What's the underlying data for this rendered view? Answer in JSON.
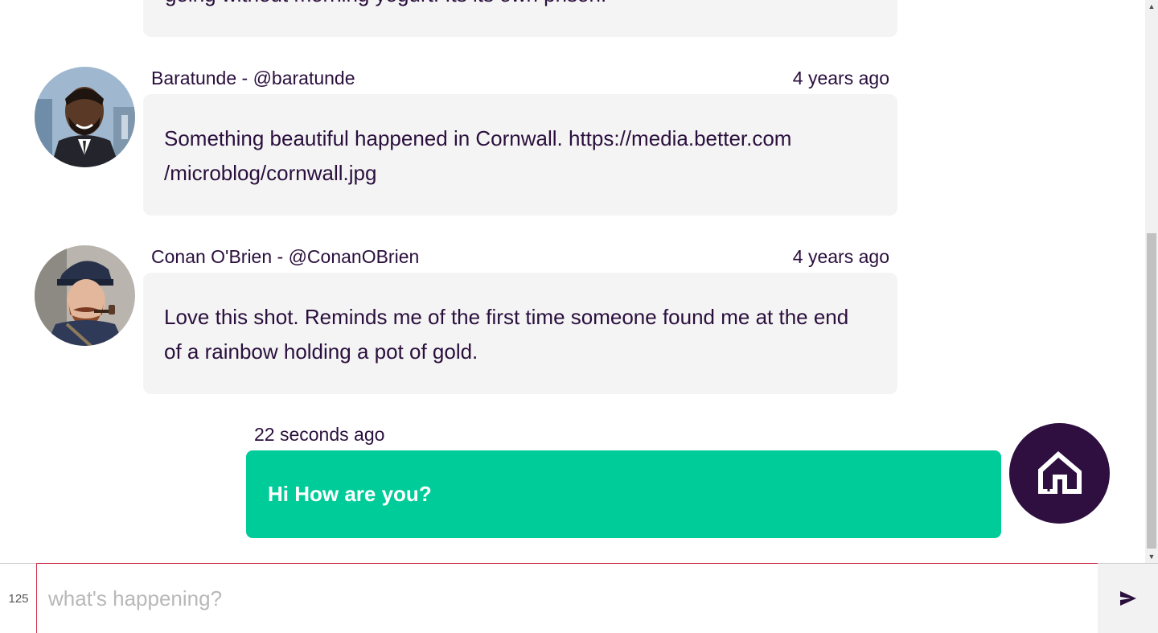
{
  "feed": {
    "truncated_text": "going without morning yogurt. Its its own prison.",
    "messages": [
      {
        "author": "Baratunde - @baratunde",
        "time": "4 years ago",
        "line1": "Something beautiful happened in Cornwall. https://media.better.com",
        "line2": "/microblog/cornwall.jpg"
      },
      {
        "author": "Conan O'Brien - @ConanOBrien",
        "time": "4 years ago",
        "line1": "Love this shot. Reminds me of the first time someone found me at the end",
        "line2": "of a rainbow holding a pot of gold."
      }
    ],
    "own": {
      "time": "22 seconds ago",
      "text": "Hi How are you?"
    }
  },
  "composer": {
    "char_count": "125",
    "placeholder": "what's happening?",
    "value": "",
    "send_icon": "send-icon"
  },
  "colors": {
    "text": "#2a0f3d",
    "own_bubble": "#00cc99",
    "own_avatar": "#2e0f3f",
    "bubble": "#f4f4f4",
    "input_border": "#d0324a"
  }
}
